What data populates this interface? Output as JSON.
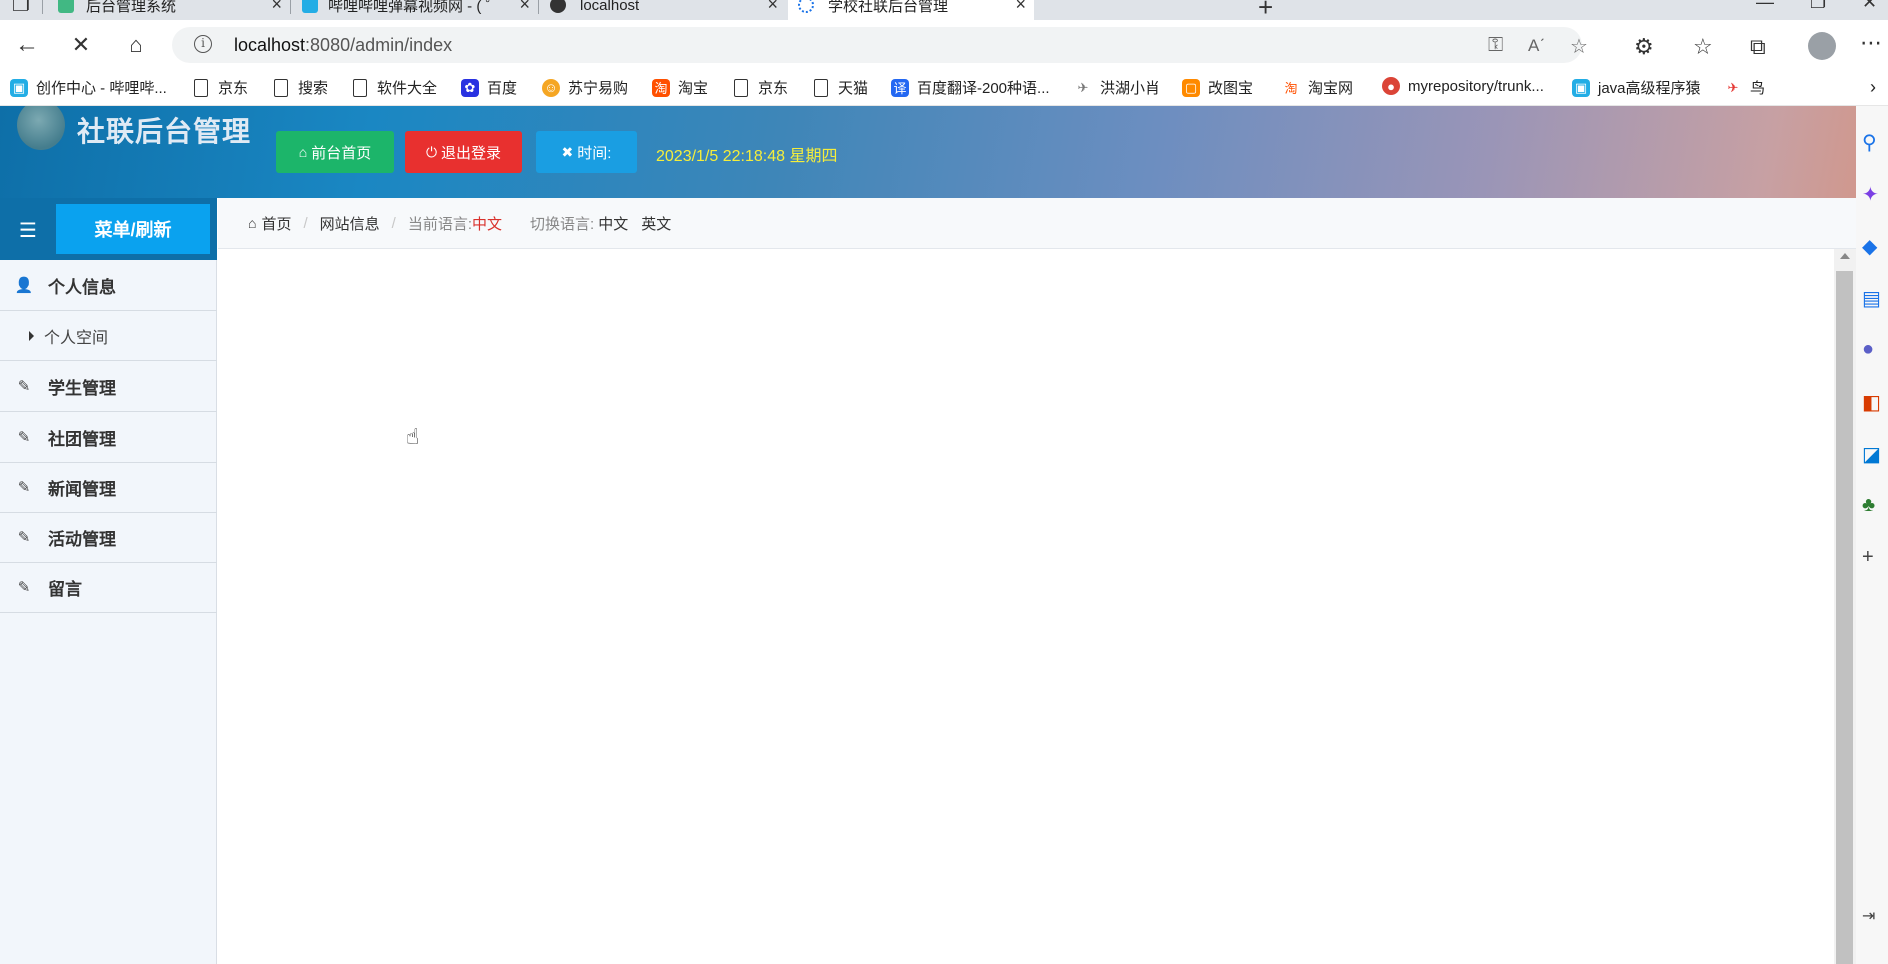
{
  "browser": {
    "tabs": [
      {
        "title": "后台管理系统",
        "favicon_color": "#41b883"
      },
      {
        "title": "哔哩哔哩弹幕视频网 - ( ゜- ゜)つロ",
        "favicon_color": "#23ade5"
      },
      {
        "title": "localhost",
        "favicon_color": "#333333"
      },
      {
        "title": "学校社联后台管理",
        "favicon_color": "#1a73e8",
        "active": true
      }
    ],
    "new_tab_icon": "plus-icon",
    "address": {
      "host": "localhost",
      "path": ":8080/admin/index"
    },
    "bookmarks": [
      {
        "label": "创作中心 - 哔哩哔...",
        "icon": "bilibili-icon",
        "color": "#23ade5"
      },
      {
        "label": "京东",
        "icon": "page-icon"
      },
      {
        "label": "搜索",
        "icon": "page-icon"
      },
      {
        "label": "软件大全",
        "icon": "page-icon"
      },
      {
        "label": "百度",
        "icon": "baidu-icon",
        "color": "#2932e1"
      },
      {
        "label": "苏宁易购",
        "icon": "suning-icon",
        "color": "#f5a623"
      },
      {
        "label": "淘宝",
        "icon": "taobao-icon",
        "color": "#ff5000"
      },
      {
        "label": "京东",
        "icon": "page-icon"
      },
      {
        "label": "天猫",
        "icon": "page-icon"
      },
      {
        "label": "百度翻译-200种语...",
        "icon": "translate-icon",
        "color": "#2468f2"
      },
      {
        "label": "洪湖小肖",
        "icon": "bird-icon",
        "color": "#777777"
      },
      {
        "label": "改图宝",
        "icon": "gaitubao-icon",
        "color": "#ff8a00"
      },
      {
        "label": "淘宝网",
        "icon": "taobao-icon",
        "color": "#ff5000"
      },
      {
        "label": "myrepository/trunk...",
        "icon": "chrome-icon",
        "color": "#db4437"
      },
      {
        "label": "java高级程序猿",
        "icon": "bilibili-icon",
        "color": "#23ade5"
      },
      {
        "label": "鸟",
        "icon": "bird-icon",
        "color": "#e53935"
      }
    ]
  },
  "app": {
    "title": "社联后台管理",
    "header_buttons": {
      "home": "前台首页",
      "logout": "退出登录",
      "time": "时间:"
    },
    "clock": "2023/1/5 22:18:48 星期四",
    "colors": {
      "header_start": "#0e6fa8",
      "home_btn": "#1cb56a",
      "logout_btn": "#e8302f",
      "time_btn": "#1a9ee2",
      "clock_text": "#f5ee3b"
    },
    "sidebar": {
      "menu_refresh": "菜单/刷新",
      "items": [
        {
          "label": "个人信息",
          "icon": "user-icon"
        },
        {
          "label": "个人空间",
          "sub": true
        },
        {
          "label": "学生管理",
          "icon": "edit-icon"
        },
        {
          "label": "社团管理",
          "icon": "edit-icon"
        },
        {
          "label": "新闻管理",
          "icon": "edit-icon"
        },
        {
          "label": "活动管理",
          "icon": "edit-icon"
        },
        {
          "label": "留言",
          "icon": "edit-icon"
        }
      ]
    },
    "breadcrumb": {
      "home": "首页",
      "site_info": "网站信息",
      "current_lang_label": "当前语言:",
      "current_lang": "中文",
      "switch_lang_label": "切换语言:",
      "lang_zh": "中文",
      "lang_en": "英文"
    }
  }
}
